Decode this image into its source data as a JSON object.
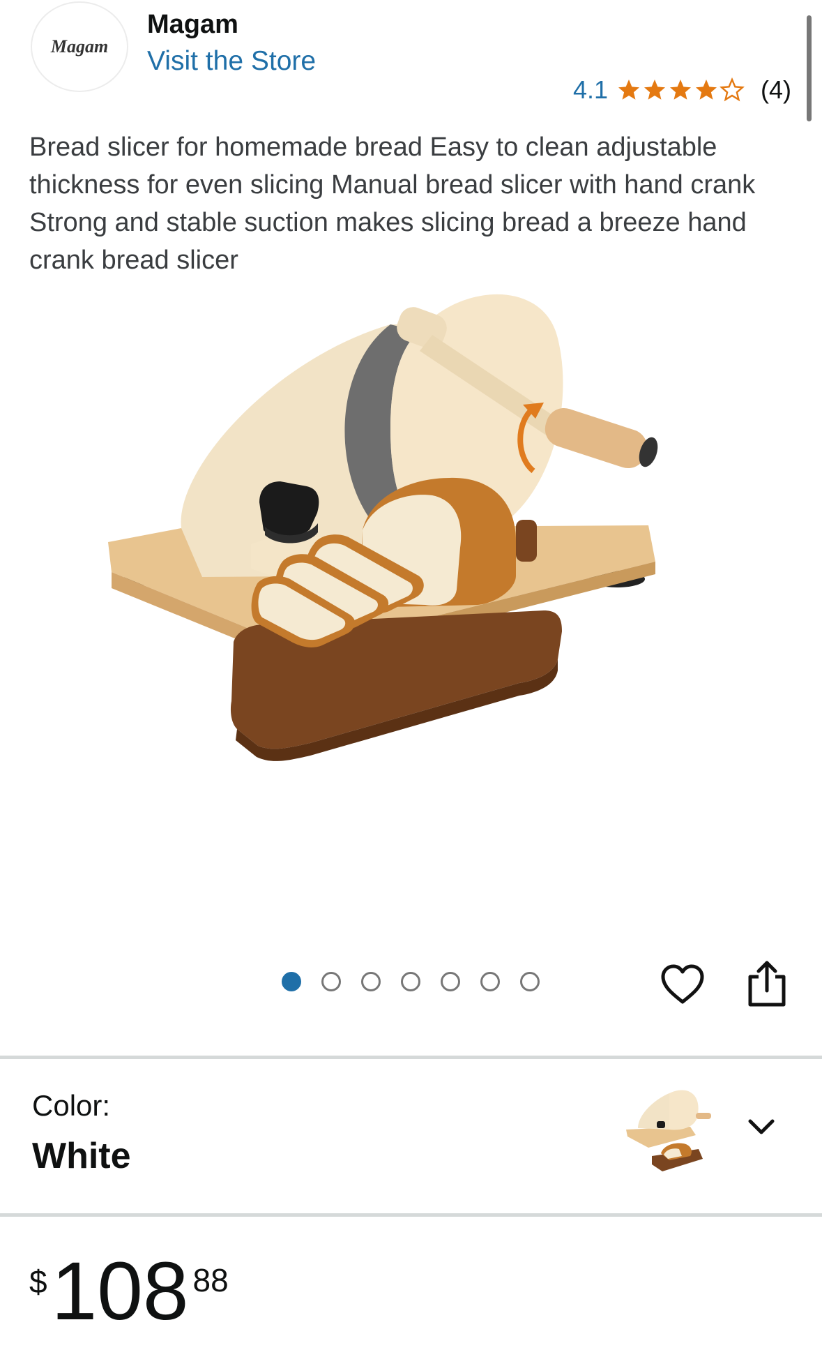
{
  "brand": {
    "logo_text": "Magam",
    "name": "Magam",
    "visit_store": "Visit the Store"
  },
  "rating": {
    "value": "4.1",
    "stars": 4.1,
    "count": "(4)"
  },
  "product": {
    "title": "Bread slicer for homemade bread Easy to clean adjustable thickness for even slicing Manual bread slicer with hand crank Strong and stable suction makes slicing bread a breeze hand crank bread slicer"
  },
  "carousel": {
    "total_images": 7,
    "active_index": 0
  },
  "color": {
    "label": "Color:",
    "value": "White"
  },
  "price": {
    "symbol": "$",
    "whole": "108",
    "fraction": "88"
  },
  "colors": {
    "link": "#1f6fa8",
    "star": "#e47911",
    "text": "#0f1111",
    "divider": "#d5d9d9"
  },
  "icons": [
    "heart-icon",
    "share-icon",
    "chevron-down-icon",
    "star-icon"
  ]
}
